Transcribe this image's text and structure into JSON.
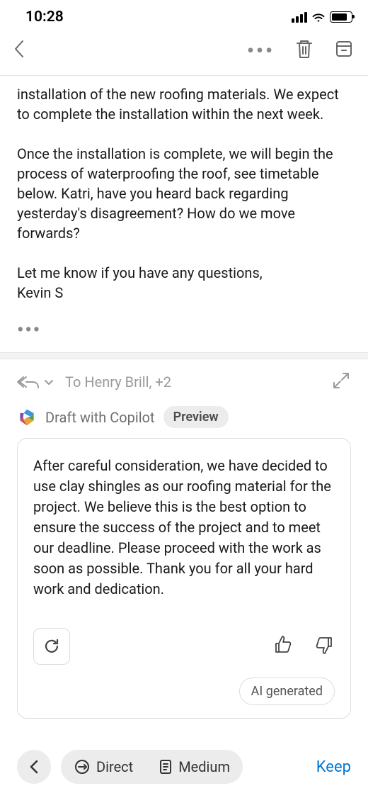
{
  "status": {
    "time": "10:28"
  },
  "email": {
    "para1": "installation of the new roofing materials. We expect to complete the installation within the next week.",
    "para2": "Once the installation is complete, we will begin the process of waterproofing the roof, see timetable below. Katri, have you heard back regarding yesterday's disagreement? How do we move forwards?",
    "closing": "Let me know if you have any questions,",
    "signature": "Kevin S"
  },
  "reply": {
    "to_label": "To Henry Brill, +2"
  },
  "copilot": {
    "label": "Draft with Copilot",
    "badge": "Preview",
    "draft": "After careful consideration, we have decided to use clay shingles as our roofing material for the project. We believe this is the best option to ensure the success of the project and to meet our deadline. Please proceed with the work as soon as possible.  Thank you for all your hard work and dedication.",
    "ai_generated": "AI generated"
  },
  "bottom": {
    "direct": "Direct",
    "medium": "Medium",
    "keep": "Keep"
  }
}
